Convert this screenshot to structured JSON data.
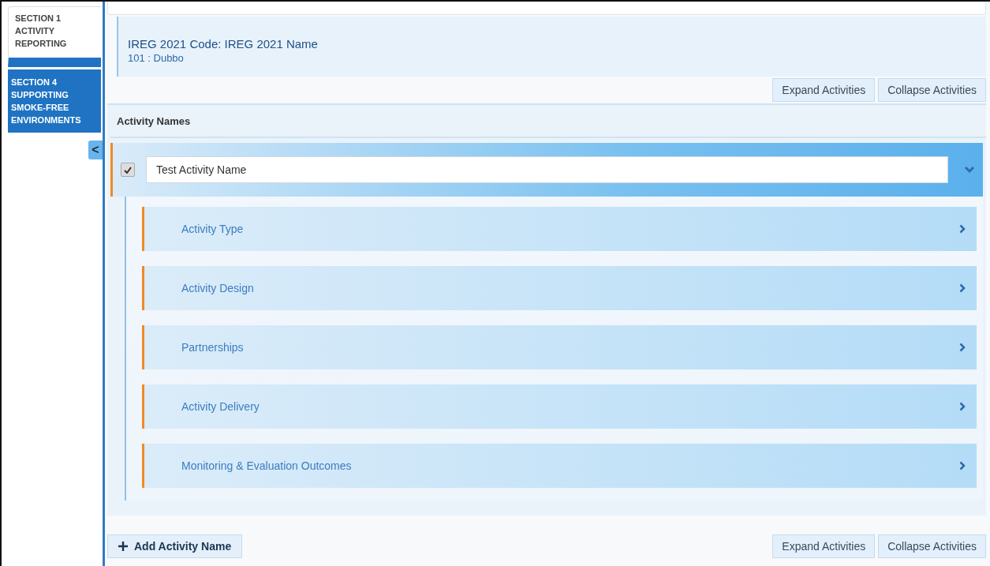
{
  "sidebar": {
    "tabs": [
      {
        "label": "SECTION 1\nACTIVITY\nREPORTING",
        "selected": true
      },
      {
        "label": "SECTION 4\nSUPPORTING\nSMOKE-FREE\nENVIRONMENTS",
        "selected": false
      }
    ],
    "collapse_button": "<"
  },
  "region": {
    "heading": "IREG 2021 Code: IREG 2021 Name",
    "value": "101 : Dubbo"
  },
  "top_buttons": [
    "Expand Activities",
    "Collapse Activities"
  ],
  "activity_names": {
    "heading": "Activity Names",
    "activities": [
      {
        "checked": true,
        "name": "Test Activity Name",
        "expanded": true,
        "sections": [
          {
            "label": "Activity Type"
          },
          {
            "label": "Activity Design"
          },
          {
            "label": "Partnerships"
          },
          {
            "label": "Activity Delivery"
          },
          {
            "label": "Monitoring & Evaluation Outcomes"
          }
        ]
      }
    ]
  },
  "add_button": "Add Activity Name",
  "bottom_buttons": [
    "Expand Activities",
    "Collapse Activities"
  ]
}
